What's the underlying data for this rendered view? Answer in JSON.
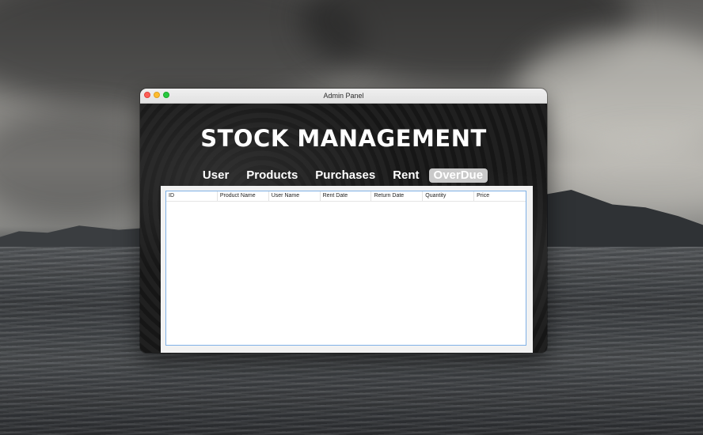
{
  "window": {
    "title": "Admin Panel"
  },
  "app": {
    "heading": "STOCK MANAGEMENT"
  },
  "nav": {
    "items": [
      {
        "label": "User"
      },
      {
        "label": "Products"
      },
      {
        "label": "Purchases"
      },
      {
        "label": "Rent"
      },
      {
        "label": "OverDue",
        "active": true
      }
    ]
  },
  "table": {
    "columns": [
      "ID",
      "Product Name",
      "User Name",
      "Rent Date",
      "Return Date",
      "Quantity",
      "Price"
    ],
    "rows": []
  },
  "colors": {
    "accent_active_tab": "#c9c9c9",
    "table_border": "#7fb1e6",
    "close_button": "#ff5f57",
    "minimize_button": "#febc2e",
    "maximize_button": "#28c840"
  }
}
